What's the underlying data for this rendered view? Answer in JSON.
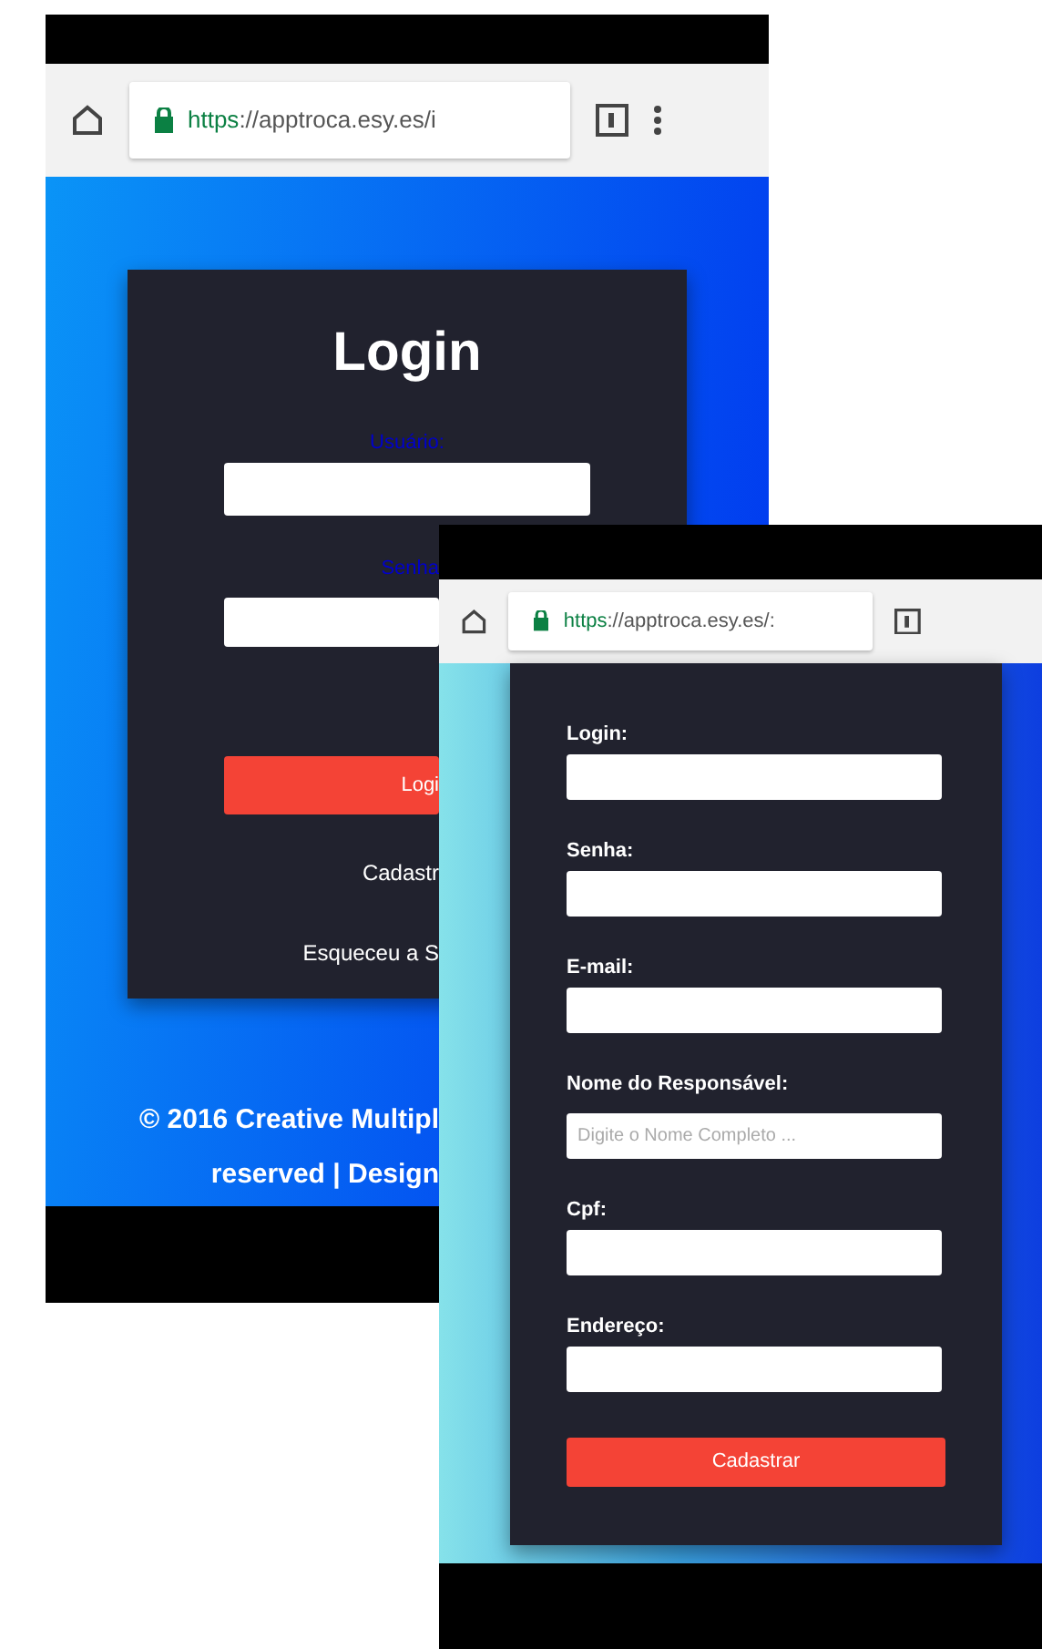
{
  "screens": [
    {
      "kind": "login",
      "url_scheme": "https",
      "url_rest": "://apptroca.esy.es/i",
      "title": "Login",
      "fields": [
        {
          "label": "Usuário:"
        },
        {
          "label": "Senha"
        }
      ],
      "button": "Logi",
      "links": [
        "Cadastr",
        "Esqueceu a S"
      ],
      "footer": [
        "© 2016 Creative Multipl",
        "reserved | Design"
      ]
    },
    {
      "kind": "signup",
      "url_scheme": "https",
      "url_rest": "://apptroca.esy.es/:",
      "fields": [
        {
          "label": "Login:"
        },
        {
          "label": "Senha:"
        },
        {
          "label": "E-mail:"
        },
        {
          "label": "Nome do Responsável:",
          "placeholder": "Digite o Nome Completo ..."
        },
        {
          "label": "Cpf:"
        },
        {
          "label": "Endereço:"
        }
      ],
      "button": "Cadastrar"
    }
  ]
}
